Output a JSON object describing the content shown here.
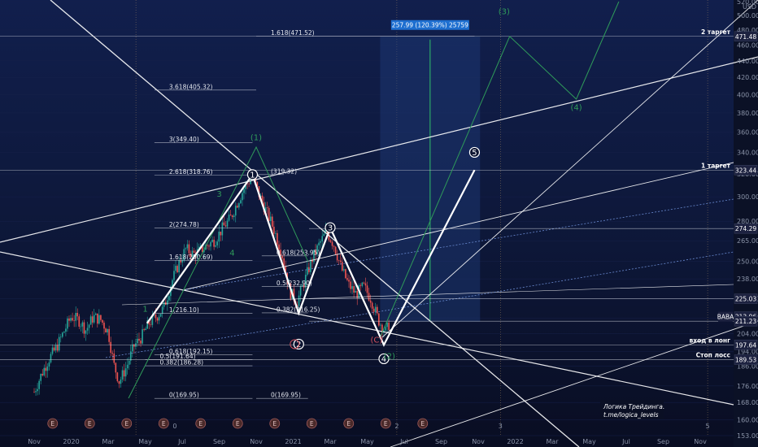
{
  "ticker": "BABA",
  "currency": "USD",
  "colors": {
    "bg_top": "#101f4a",
    "bg_bottom": "#0a0f24",
    "candle_up": "#26a69a",
    "candle_down": "#ef5350",
    "line_white": "#ffffff",
    "green": "#2f9a5a",
    "red": "#d0505c",
    "dark_tag": "#1d2240"
  },
  "chart_data": {
    "type": "candlestick",
    "ylim": [
      153,
      520
    ],
    "y_ticks": [
      153,
      160,
      168,
      176,
      186,
      194,
      204,
      213,
      225,
      238,
      250,
      265,
      280,
      300,
      320,
      340,
      360,
      380,
      400,
      420,
      440,
      460,
      480,
      500,
      520
    ],
    "x_labels": [
      {
        "label": "Nov",
        "t": 0
      },
      {
        "label": "2020",
        "t": 2
      },
      {
        "label": "Mar",
        "t": 4
      },
      {
        "label": "May",
        "t": 6
      },
      {
        "label": "Jul",
        "t": 8
      },
      {
        "label": "Sep",
        "t": 10
      },
      {
        "label": "Nov",
        "t": 12
      },
      {
        "label": "2021",
        "t": 14
      },
      {
        "label": "Mar",
        "t": 16
      },
      {
        "label": "May",
        "t": 18
      },
      {
        "label": "Jul",
        "t": 20
      },
      {
        "label": "Sep",
        "t": 22
      },
      {
        "label": "Nov",
        "t": 24
      },
      {
        "label": "2022",
        "t": 26
      },
      {
        "label": "Mar",
        "t": 28
      },
      {
        "label": "May",
        "t": 30
      },
      {
        "label": "Jul",
        "t": 32
      },
      {
        "label": "Sep",
        "t": 34
      },
      {
        "label": "Nov",
        "t": 36
      }
    ],
    "price_series": [
      [
        0,
        173
      ],
      [
        0.4,
        182
      ],
      [
        0.8,
        190
      ],
      [
        1.2,
        196
      ],
      [
        1.6,
        205
      ],
      [
        2,
        214
      ],
      [
        2.4,
        212
      ],
      [
        2.8,
        206
      ],
      [
        3.2,
        214
      ],
      [
        3.6,
        212
      ],
      [
        4,
        205
      ],
      [
        4.3,
        187
      ],
      [
        4.6,
        178
      ],
      [
        5,
        186
      ],
      [
        5.4,
        197
      ],
      [
        5.8,
        202
      ],
      [
        6.2,
        210
      ],
      [
        6.6,
        214
      ],
      [
        7,
        219
      ],
      [
        7.4,
        235
      ],
      [
        7.8,
        248
      ],
      [
        8.2,
        259
      ],
      [
        8.6,
        255
      ],
      [
        9,
        258
      ],
      [
        9.4,
        262
      ],
      [
        9.8,
        266
      ],
      [
        10.2,
        275
      ],
      [
        10.6,
        282
      ],
      [
        11,
        296
      ],
      [
        11.4,
        309
      ],
      [
        11.8,
        318
      ],
      [
        12.2,
        300
      ],
      [
        12.6,
        286
      ],
      [
        13,
        272
      ],
      [
        13.4,
        255
      ],
      [
        13.8,
        230
      ],
      [
        14.2,
        223
      ],
      [
        14.6,
        236
      ],
      [
        15,
        251
      ],
      [
        15.4,
        262
      ],
      [
        15.8,
        272
      ],
      [
        16.2,
        262
      ],
      [
        16.6,
        245
      ],
      [
        17,
        234
      ],
      [
        17.4,
        228
      ],
      [
        17.8,
        233
      ],
      [
        18.2,
        225
      ],
      [
        18.6,
        212
      ],
      [
        19,
        205
      ],
      [
        19.2,
        210
      ]
    ],
    "waves": {
      "main_white": [
        {
          "t": 6.1,
          "p": 210
        },
        {
          "t": 11.8,
          "p": 319.32
        },
        {
          "t": 14.3,
          "p": 216.1
        },
        {
          "t": 16.0,
          "p": 275
        },
        {
          "t": 18.9,
          "p": 197.6
        },
        {
          "t": 23.8,
          "p": 323.44
        }
      ],
      "green_projection": [
        {
          "t": 18.7,
          "p": 202
        },
        {
          "t": 25.7,
          "p": 471.48
        },
        {
          "t": 29.3,
          "p": 395
        },
        {
          "t": 31.6,
          "p": 520
        }
      ],
      "green_wave1": [
        {
          "t": 5.1,
          "p": 170
        },
        {
          "t": 12.0,
          "p": 345
        },
        {
          "t": 14.8,
          "p": 250
        }
      ]
    },
    "wave_labels": [
      {
        "text": "1",
        "t": 11.8,
        "p": 319.32,
        "style": "circle-white"
      },
      {
        "text": "2",
        "t": 14.3,
        "p": 198,
        "style": "circle-white"
      },
      {
        "text": "3",
        "t": 16.0,
        "p": 275,
        "style": "circle-white"
      },
      {
        "text": "4",
        "t": 18.9,
        "p": 190,
        "style": "circle-white"
      },
      {
        "text": "5",
        "t": 23.8,
        "p": 340,
        "style": "circle-white"
      },
      {
        "text": "(1)",
        "t": 12.0,
        "p": 352,
        "style": "green"
      },
      {
        "text": "2",
        "t": 14.3,
        "p": 198,
        "style": "red-circle"
      },
      {
        "text": "(2)",
        "t": 19.2,
        "p": 190,
        "style": "green"
      },
      {
        "text": "(3)",
        "t": 25.4,
        "p": 502,
        "style": "green"
      },
      {
        "text": "(4)",
        "t": 29.3,
        "p": 383,
        "style": "green"
      },
      {
        "text": "(C)",
        "t": 18.5,
        "p": 199,
        "style": "red"
      },
      {
        "text": "1",
        "t": 6.0,
        "p": 217,
        "style": "green-small"
      },
      {
        "text": "3",
        "t": 10.0,
        "p": 300,
        "style": "green-small"
      },
      {
        "text": "4",
        "t": 10.7,
        "p": 254,
        "style": "green-small"
      }
    ],
    "fib_levels": [
      {
        "label": "1.618(471.52)",
        "t0": 12.0,
        "t1": 23.8,
        "p": 471.5
      },
      {
        "label": "3.618(405.32)",
        "t0": 6.5,
        "t1": 12.0,
        "p": 405.3
      },
      {
        "label": "3(349.40)",
        "t0": 6.5,
        "t1": 11.8,
        "p": 349.4
      },
      {
        "label": "2.618(318.76)",
        "t0": 6.5,
        "t1": 11.8,
        "p": 318.76
      },
      {
        "label": "(319.32)",
        "t0": 12.0,
        "t1": 13.5,
        "p": 319.32
      },
      {
        "label": "2(274.78)",
        "t0": 6.5,
        "t1": 11.8,
        "p": 274.78
      },
      {
        "label": "1.618(250.69)",
        "t0": 6.5,
        "t1": 11.8,
        "p": 250.69
      },
      {
        "label": "0.618(253.95)",
        "t0": 12.3,
        "t1": 14.8,
        "p": 253.95
      },
      {
        "label": "0.5(232.90)",
        "t0": 12.3,
        "t1": 14.8,
        "p": 232.9
      },
      {
        "label": "1(216.10)",
        "t0": 6.5,
        "t1": 11.8,
        "p": 216.1
      },
      {
        "label": "0.382(216.25)",
        "t0": 12.3,
        "t1": 14.8,
        "p": 216.25
      },
      {
        "label": "0.618(192.15)",
        "t0": 6.5,
        "t1": 11.8,
        "p": 192.15
      },
      {
        "label": "0.5(191.64)",
        "t0": 6.0,
        "t1": 11.8,
        "p": 189.6
      },
      {
        "label": "0.382(186.28)",
        "t0": 6.0,
        "t1": 11.8,
        "p": 186.28
      },
      {
        "label": "0(169.95)",
        "t0": 6.5,
        "t1": 11.8,
        "p": 169.95
      },
      {
        "label": "0(169.95)",
        "t0": 12.0,
        "t1": 14.8,
        "p": 169.95
      }
    ],
    "horizontal_levels": [
      {
        "p": 471.48,
        "tag": "2 таргет"
      },
      {
        "p": 323.44,
        "tag": "1 таргет"
      },
      {
        "p": 274.29,
        "tag": ""
      },
      {
        "p": 225.03,
        "tag": ""
      },
      {
        "p": 211.23,
        "tag": ""
      },
      {
        "p": 197.64,
        "tag": "вход в лонг"
      },
      {
        "p": 189.53,
        "tag": "Стоп лосс"
      }
    ],
    "price_tags": [
      {
        "text": "471.48",
        "p": 471.48,
        "color": "#1d2240"
      },
      {
        "text": "323.44",
        "p": 323.44,
        "color": "#1d2240"
      },
      {
        "text": "274.29",
        "p": 274.29,
        "color": "#1d2240"
      },
      {
        "text": "225.03",
        "p": 225.03,
        "color": "#1d2240"
      },
      {
        "text": "213.96",
        "p": 213.96,
        "color": "#1d2240"
      },
      {
        "text": "211.23",
        "p": 211.23,
        "color": "#1d2240"
      },
      {
        "text": "197.64",
        "p": 197.64,
        "color": "#1d2240"
      },
      {
        "text": "189.53",
        "p": 189.53,
        "color": "#1d2240"
      }
    ],
    "projection_box": {
      "t0": 18.7,
      "t1": 24.1,
      "p0": 211,
      "p1": 471.5,
      "label": "257.99 (120.39%) 25759"
    },
    "annotation": {
      "lines": [
        "Логика Трейдинга.",
        "t.me/logica_levels"
      ]
    },
    "earnings_markers": [
      1,
      3,
      5,
      7,
      9,
      11,
      13,
      15,
      17,
      19,
      21
    ],
    "bottom_numbers": [
      {
        "text": "0",
        "t": 7.6
      },
      {
        "text": "2",
        "t": 19.6
      },
      {
        "text": "3",
        "t": 25.2
      },
      {
        "text": "5",
        "t": 36.4
      }
    ],
    "last_price_label": "BABA"
  }
}
